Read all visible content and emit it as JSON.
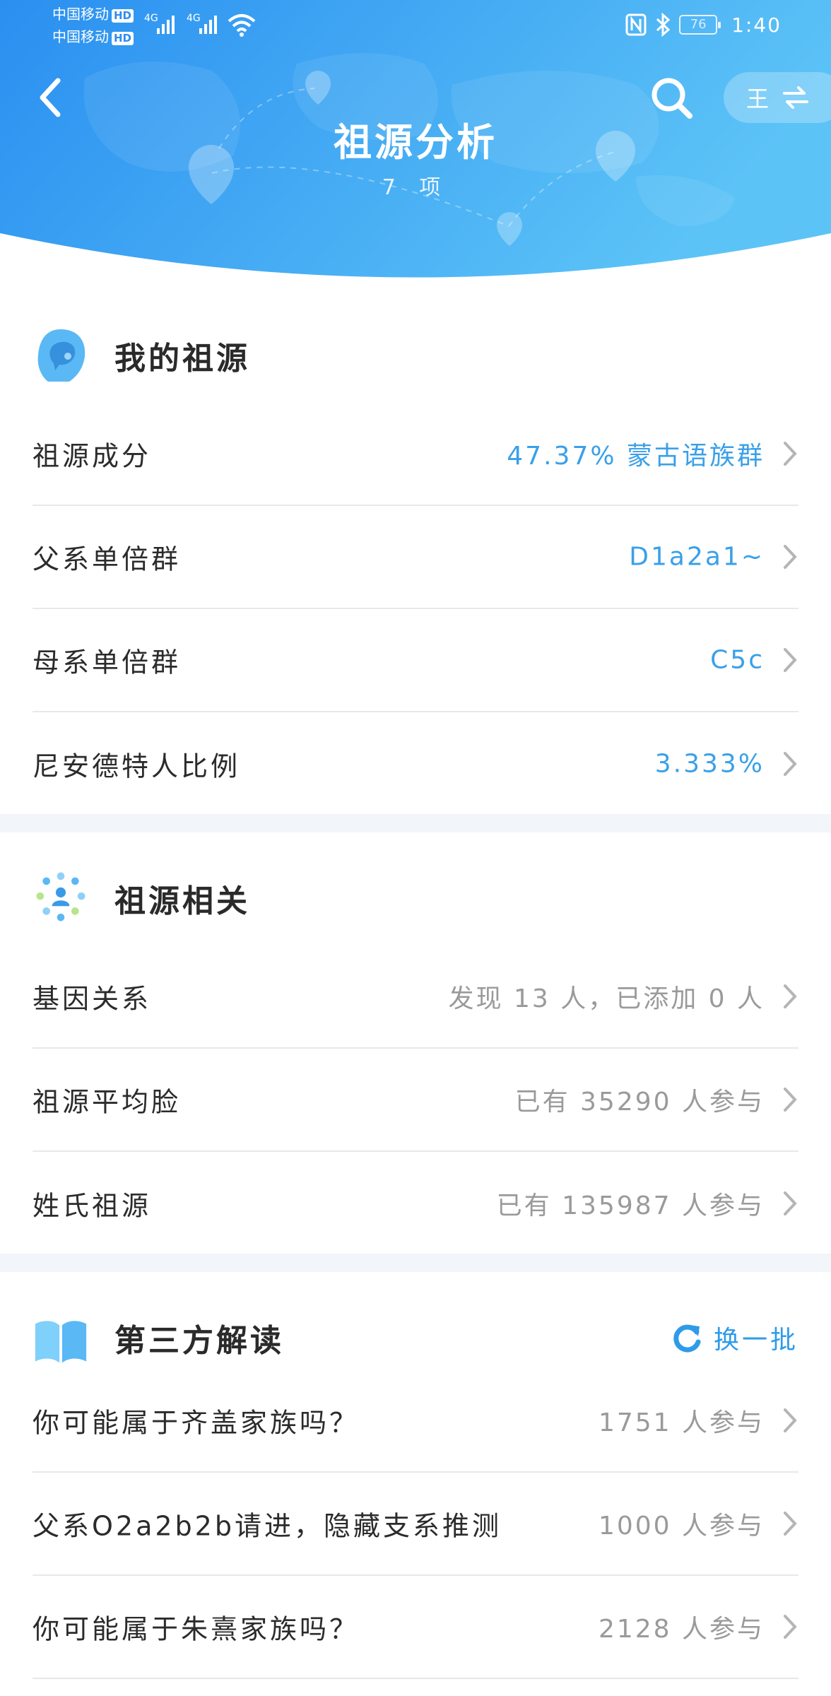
{
  "status_bar": {
    "carrier1": "中国移动",
    "carrier2": "中国移动",
    "hd": "HD",
    "net1": "4G",
    "net2": "4G",
    "battery": "76",
    "time": "1:40"
  },
  "header": {
    "title": "祖源分析",
    "subtitle": "7 项",
    "switch_label": "王"
  },
  "colors": {
    "header_start": "#2a8ff0",
    "header_end": "#5cc3f7",
    "value_blue": "#3aa0e8",
    "value_gray": "#9a9a9a"
  },
  "my_ancestry": {
    "title": "我的祖源",
    "rows": [
      {
        "label": "祖源成分",
        "value": "47.37% 蒙古语族群"
      },
      {
        "label": "父系单倍群",
        "value": "D1a2a1~"
      },
      {
        "label": "母系单倍群",
        "value": "C5c"
      },
      {
        "label": "尼安德特人比例",
        "value": "3.333%"
      }
    ]
  },
  "ancestry_related": {
    "title": "祖源相关",
    "rows": [
      {
        "label": "基因关系",
        "value": "发现 13 人，已添加 0 人"
      },
      {
        "label": "祖源平均脸",
        "value": "已有 35290 人参与"
      },
      {
        "label": "姓氏祖源",
        "value": "已有 135987 人参与"
      }
    ]
  },
  "third_party": {
    "title": "第三方解读",
    "refresh_label": "换一批",
    "rows": [
      {
        "label": "你可能属于齐盖家族吗？",
        "value": "1751 人参与"
      },
      {
        "label": "父系O2a2b2b请进，隐藏支系推测",
        "value": "1000 人参与"
      },
      {
        "label": "你可能属于朱熹家族吗？",
        "value": "2128 人参与"
      }
    ]
  }
}
